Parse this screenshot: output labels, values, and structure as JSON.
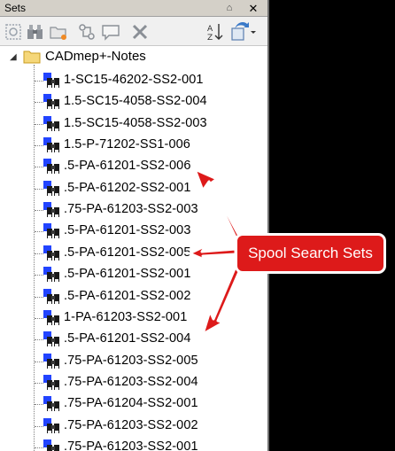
{
  "titlebar": {
    "title": "Sets",
    "pin_glyph": "⌂",
    "close_glyph": "✕"
  },
  "toolbar": {
    "icons": [
      "save-selection-icon",
      "binoculars-search-icon",
      "new-folder-icon",
      "update-icon",
      "comment-icon",
      "delete-icon",
      "sort-icon",
      "import-export-icon"
    ]
  },
  "tree": {
    "root": {
      "label": "CADmep+-Notes",
      "toggle": "◢"
    },
    "items": [
      "1-SC15-46202-SS2-001",
      "1.5-SC15-4058-SS2-004",
      "1.5-SC15-4058-SS2-003",
      "1.5-P-71202-SS1-006",
      ".5-PA-61201-SS2-006",
      ".5-PA-61202-SS2-001",
      ".75-PA-61203-SS2-003",
      ".5-PA-61201-SS2-003",
      ".5-PA-61201-SS2-005",
      ".5-PA-61201-SS2-001",
      ".5-PA-61201-SS2-002",
      "1-PA-61203-SS2-001",
      ".5-PA-61201-SS2-004",
      ".75-PA-61203-SS2-005",
      ".75-PA-61203-SS2-004",
      ".75-PA-61204-SS2-001",
      ".75-PA-61203-SS2-002",
      ".75-PA-61203-SS2-001"
    ]
  },
  "annotation": {
    "text": "Spool Search Sets",
    "color": "#dd1a1a"
  }
}
